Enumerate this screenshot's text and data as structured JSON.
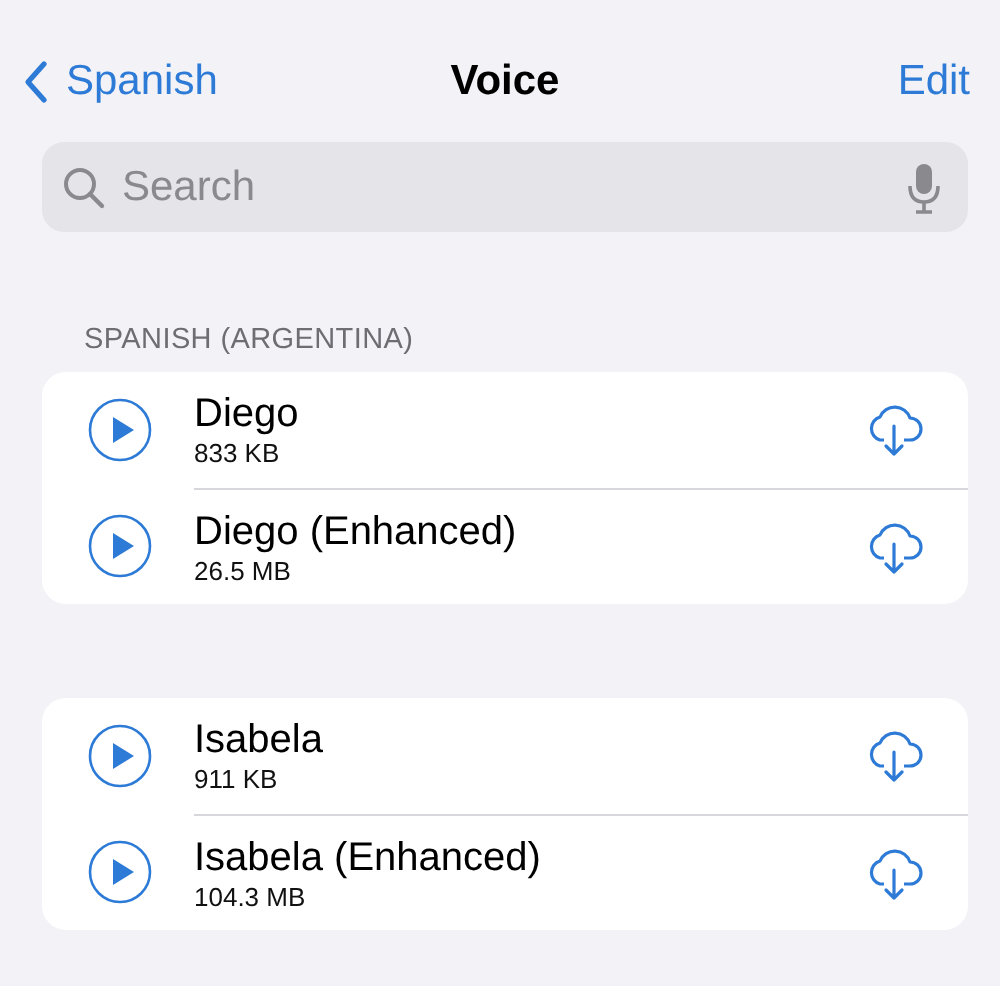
{
  "nav": {
    "back": "Spanish",
    "title": "Voice",
    "action": "Edit"
  },
  "search": {
    "placeholder": "Search"
  },
  "sections": [
    {
      "header": "SPANISH (ARGENTINA)",
      "voices": [
        {
          "name": "Diego",
          "size": "833 KB"
        },
        {
          "name": "Diego (Enhanced)",
          "size": "26.5 MB"
        }
      ]
    },
    {
      "voices": [
        {
          "name": "Isabela",
          "size": "911 KB"
        },
        {
          "name": "Isabela (Enhanced)",
          "size": "104.3 MB"
        }
      ]
    }
  ]
}
